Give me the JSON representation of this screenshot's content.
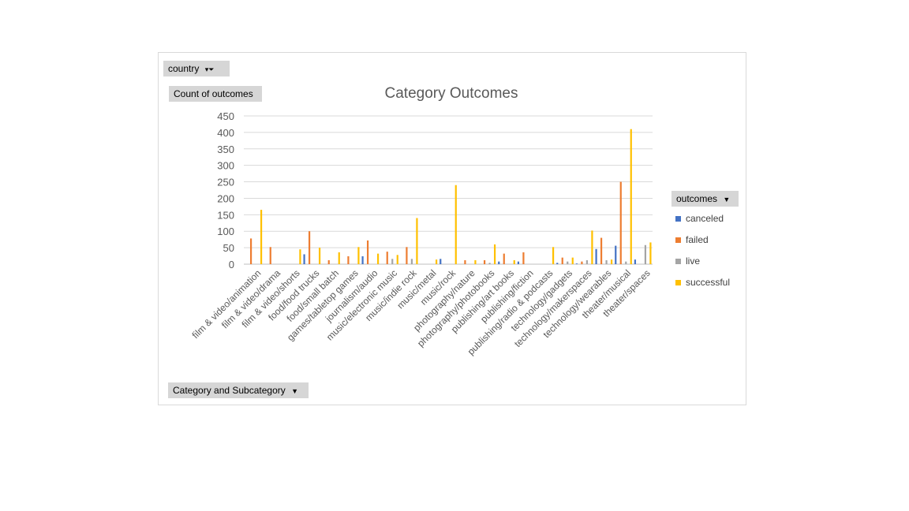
{
  "filters": {
    "country_label": "country",
    "count_label": "Count of outcomes",
    "category_label": "Category and Subcategory",
    "outcomes_label": "outcomes"
  },
  "chart_data": {
    "type": "bar",
    "title": "Category Outcomes",
    "xlabel": "",
    "ylabel": "",
    "ylim": [
      0,
      450
    ],
    "yticks": [
      0,
      50,
      100,
      150,
      200,
      250,
      300,
      350,
      400,
      450
    ],
    "grid": true,
    "legend_position": "right",
    "categories": [
      "film & video/animation",
      "film & video/drama",
      "film & video/shorts",
      "food/food trucks",
      "food/small batch",
      "games/tabletop games",
      "journalism/audio",
      "music/electronic music",
      "music/indie rock",
      "music/metal",
      "music/rock",
      "photography/nature",
      "photography/photobooks",
      "publishing/art books",
      "publishing/fiction",
      "publishing/radio & podcasts",
      "technology/gadgets",
      "technology/makerspaces",
      "technology/wearables",
      "theater/musical",
      "theater/spaces"
    ],
    "series": [
      {
        "name": "canceled",
        "color": "#4472c4",
        "values": [
          0,
          0,
          0,
          30,
          0,
          0,
          24,
          0,
          0,
          0,
          16,
          0,
          0,
          8,
          8,
          0,
          4,
          2,
          46,
          56,
          14
        ]
      },
      {
        "name": "failed",
        "color": "#ed7d31",
        "values": [
          78,
          52,
          0,
          100,
          12,
          24,
          72,
          38,
          52,
          0,
          0,
          12,
          12,
          32,
          36,
          0,
          20,
          8,
          80,
          250,
          0
        ]
      },
      {
        "name": "live",
        "color": "#a5a5a5",
        "values": [
          0,
          0,
          0,
          0,
          0,
          0,
          0,
          16,
          16,
          0,
          0,
          0,
          4,
          0,
          0,
          0,
          8,
          12,
          12,
          8,
          58
        ]
      },
      {
        "name": "successful",
        "color": "#ffc000",
        "values": [
          165,
          0,
          45,
          50,
          36,
          52,
          32,
          28,
          140,
          14,
          240,
          12,
          60,
          12,
          0,
          52,
          20,
          102,
          14,
          410,
          66
        ]
      }
    ]
  }
}
